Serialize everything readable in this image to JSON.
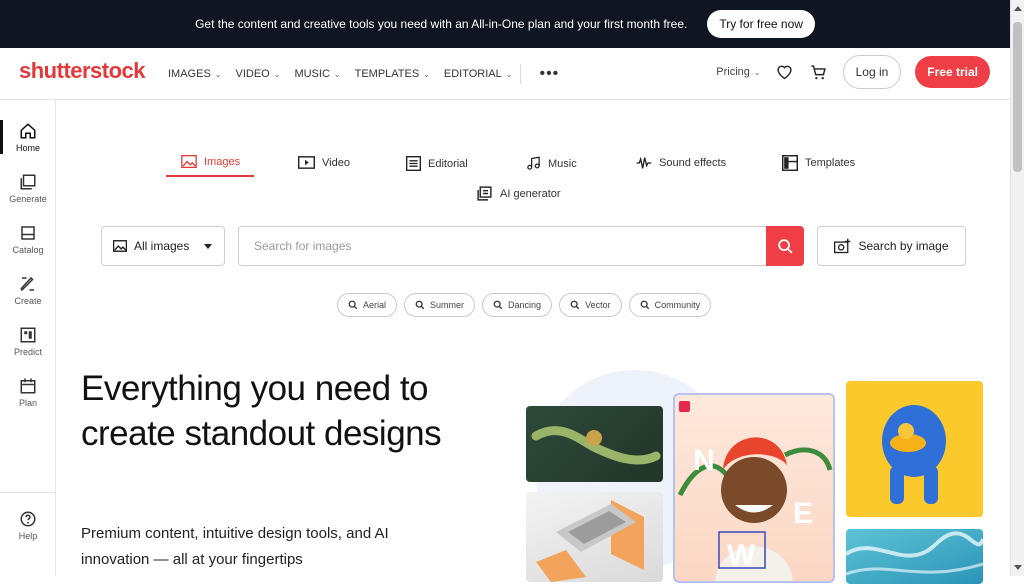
{
  "promo": {
    "text": "Get the content and creative tools you need with an All-in-One plan and your first month free.",
    "button": "Try for free now"
  },
  "header": {
    "logo": "shutterstock",
    "nav": [
      "IMAGES",
      "VIDEO",
      "MUSIC",
      "TEMPLATES",
      "EDITORIAL"
    ],
    "pricing": "Pricing",
    "login": "Log in",
    "trial": "Free trial"
  },
  "sidebar": {
    "items": [
      {
        "label": "Home",
        "icon": "home-icon"
      },
      {
        "label": "Generate",
        "icon": "generate-icon"
      },
      {
        "label": "Catalog",
        "icon": "catalog-icon"
      },
      {
        "label": "Create",
        "icon": "create-icon"
      },
      {
        "label": "Predict",
        "icon": "predict-icon"
      },
      {
        "label": "Plan",
        "icon": "calendar-icon"
      }
    ],
    "help": "Help"
  },
  "tabs": [
    "Images",
    "Video",
    "Editorial",
    "Music",
    "Sound effects",
    "Templates",
    "AI generator"
  ],
  "search": {
    "type": "All images",
    "placeholder": "Search for images",
    "image_search": "Search by image"
  },
  "chips": [
    "Aerial",
    "Summer",
    "Dancing",
    "Vector",
    "Community"
  ],
  "hero": {
    "title": "Everything you need to create standout designs",
    "subtitle": "Premium content, intuitive design tools, and AI innovation — all at your fingertips"
  },
  "collage_letters": [
    "N",
    "E",
    "W"
  ],
  "colors": {
    "accent": "#f03e46",
    "promo_bg": "#0f1621"
  }
}
